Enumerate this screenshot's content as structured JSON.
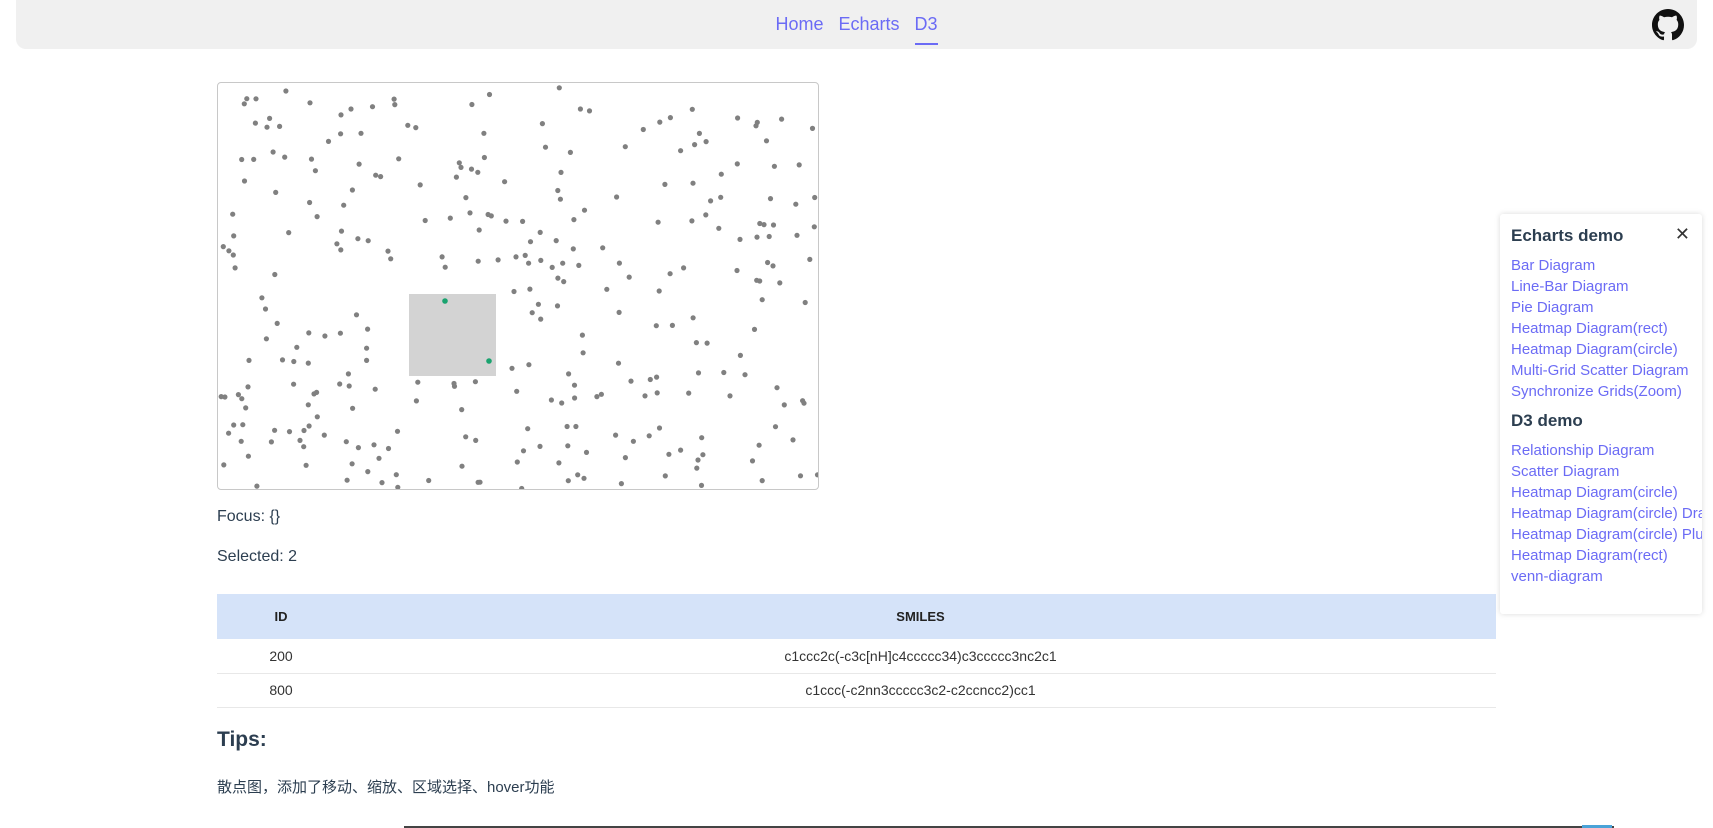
{
  "nav": {
    "links": [
      "Home",
      "Echarts",
      "D3"
    ],
    "active": "D3",
    "github_icon": "github-icon",
    "accent": "#6b6bf5"
  },
  "focus_label": "Focus: {}",
  "selected_label": "Selected: 2",
  "table": {
    "headers": [
      "ID",
      "SMILES"
    ],
    "rows": [
      [
        "200",
        "c1ccc2c(-c3c[nH]c4ccccc34)c3ccccc3nc2c1"
      ],
      [
        "800",
        "c1ccc(-c2nn3ccccc3c2-c2ccncc2)cc1"
      ]
    ],
    "header_bg": "#d5e3f9"
  },
  "tips": {
    "title": "Tips:",
    "text": "散点图，添加了移动、缩放、区域选择、hover功能"
  },
  "panel": {
    "echarts_title": "Echarts demo",
    "echarts_items": [
      "Bar Diagram",
      "Line-Bar Diagram",
      "Pie Diagram",
      "Heatmap Diagram(rect)",
      "Heatmap Diagram(circle)",
      "Multi-Grid Scatter Diagram",
      "Synchronize Grids(Zoom)"
    ],
    "d3_title": "D3 demo",
    "d3_items": [
      "Relationship Diagram",
      "Scatter Diagram",
      "Heatmap Diagram(circle)",
      "Heatmap Diagram(circle) Drag",
      "Heatmap Diagram(circle) Plus",
      "Heatmap Diagram(rect)",
      "venn-diagram"
    ],
    "close_icon": "close-icon"
  },
  "scatter": {
    "point_color": "#808080",
    "selected_color": "#1aa36f",
    "brush_color": "#d3d3d3"
  }
}
